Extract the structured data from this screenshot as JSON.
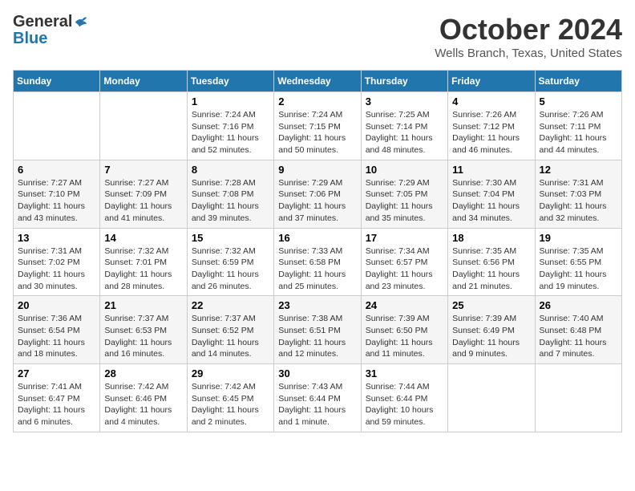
{
  "header": {
    "logo_general": "General",
    "logo_blue": "Blue",
    "month": "October 2024",
    "location": "Wells Branch, Texas, United States"
  },
  "weekdays": [
    "Sunday",
    "Monday",
    "Tuesday",
    "Wednesday",
    "Thursday",
    "Friday",
    "Saturday"
  ],
  "weeks": [
    [
      {
        "day": "",
        "info": ""
      },
      {
        "day": "",
        "info": ""
      },
      {
        "day": "1",
        "info": "Sunrise: 7:24 AM\nSunset: 7:16 PM\nDaylight: 11 hours and 52 minutes."
      },
      {
        "day": "2",
        "info": "Sunrise: 7:24 AM\nSunset: 7:15 PM\nDaylight: 11 hours and 50 minutes."
      },
      {
        "day": "3",
        "info": "Sunrise: 7:25 AM\nSunset: 7:14 PM\nDaylight: 11 hours and 48 minutes."
      },
      {
        "day": "4",
        "info": "Sunrise: 7:26 AM\nSunset: 7:12 PM\nDaylight: 11 hours and 46 minutes."
      },
      {
        "day": "5",
        "info": "Sunrise: 7:26 AM\nSunset: 7:11 PM\nDaylight: 11 hours and 44 minutes."
      }
    ],
    [
      {
        "day": "6",
        "info": "Sunrise: 7:27 AM\nSunset: 7:10 PM\nDaylight: 11 hours and 43 minutes."
      },
      {
        "day": "7",
        "info": "Sunrise: 7:27 AM\nSunset: 7:09 PM\nDaylight: 11 hours and 41 minutes."
      },
      {
        "day": "8",
        "info": "Sunrise: 7:28 AM\nSunset: 7:08 PM\nDaylight: 11 hours and 39 minutes."
      },
      {
        "day": "9",
        "info": "Sunrise: 7:29 AM\nSunset: 7:06 PM\nDaylight: 11 hours and 37 minutes."
      },
      {
        "day": "10",
        "info": "Sunrise: 7:29 AM\nSunset: 7:05 PM\nDaylight: 11 hours and 35 minutes."
      },
      {
        "day": "11",
        "info": "Sunrise: 7:30 AM\nSunset: 7:04 PM\nDaylight: 11 hours and 34 minutes."
      },
      {
        "day": "12",
        "info": "Sunrise: 7:31 AM\nSunset: 7:03 PM\nDaylight: 11 hours and 32 minutes."
      }
    ],
    [
      {
        "day": "13",
        "info": "Sunrise: 7:31 AM\nSunset: 7:02 PM\nDaylight: 11 hours and 30 minutes."
      },
      {
        "day": "14",
        "info": "Sunrise: 7:32 AM\nSunset: 7:01 PM\nDaylight: 11 hours and 28 minutes."
      },
      {
        "day": "15",
        "info": "Sunrise: 7:32 AM\nSunset: 6:59 PM\nDaylight: 11 hours and 26 minutes."
      },
      {
        "day": "16",
        "info": "Sunrise: 7:33 AM\nSunset: 6:58 PM\nDaylight: 11 hours and 25 minutes."
      },
      {
        "day": "17",
        "info": "Sunrise: 7:34 AM\nSunset: 6:57 PM\nDaylight: 11 hours and 23 minutes."
      },
      {
        "day": "18",
        "info": "Sunrise: 7:35 AM\nSunset: 6:56 PM\nDaylight: 11 hours and 21 minutes."
      },
      {
        "day": "19",
        "info": "Sunrise: 7:35 AM\nSunset: 6:55 PM\nDaylight: 11 hours and 19 minutes."
      }
    ],
    [
      {
        "day": "20",
        "info": "Sunrise: 7:36 AM\nSunset: 6:54 PM\nDaylight: 11 hours and 18 minutes."
      },
      {
        "day": "21",
        "info": "Sunrise: 7:37 AM\nSunset: 6:53 PM\nDaylight: 11 hours and 16 minutes."
      },
      {
        "day": "22",
        "info": "Sunrise: 7:37 AM\nSunset: 6:52 PM\nDaylight: 11 hours and 14 minutes."
      },
      {
        "day": "23",
        "info": "Sunrise: 7:38 AM\nSunset: 6:51 PM\nDaylight: 11 hours and 12 minutes."
      },
      {
        "day": "24",
        "info": "Sunrise: 7:39 AM\nSunset: 6:50 PM\nDaylight: 11 hours and 11 minutes."
      },
      {
        "day": "25",
        "info": "Sunrise: 7:39 AM\nSunset: 6:49 PM\nDaylight: 11 hours and 9 minutes."
      },
      {
        "day": "26",
        "info": "Sunrise: 7:40 AM\nSunset: 6:48 PM\nDaylight: 11 hours and 7 minutes."
      }
    ],
    [
      {
        "day": "27",
        "info": "Sunrise: 7:41 AM\nSunset: 6:47 PM\nDaylight: 11 hours and 6 minutes."
      },
      {
        "day": "28",
        "info": "Sunrise: 7:42 AM\nSunset: 6:46 PM\nDaylight: 11 hours and 4 minutes."
      },
      {
        "day": "29",
        "info": "Sunrise: 7:42 AM\nSunset: 6:45 PM\nDaylight: 11 hours and 2 minutes."
      },
      {
        "day": "30",
        "info": "Sunrise: 7:43 AM\nSunset: 6:44 PM\nDaylight: 11 hours and 1 minute."
      },
      {
        "day": "31",
        "info": "Sunrise: 7:44 AM\nSunset: 6:44 PM\nDaylight: 10 hours and 59 minutes."
      },
      {
        "day": "",
        "info": ""
      },
      {
        "day": "",
        "info": ""
      }
    ]
  ]
}
